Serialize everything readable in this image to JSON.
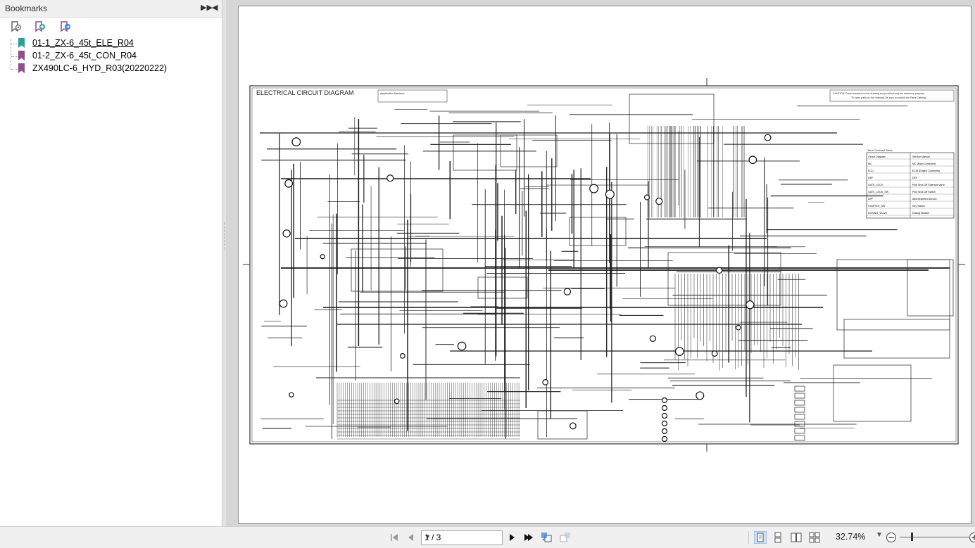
{
  "sidebar": {
    "title": "Bookmarks",
    "bookmarks": [
      {
        "label": "01-1_ZX-6_45t_ELE_R04",
        "color": "#2aa198",
        "selected": true
      },
      {
        "label": "01-2_ZX-6_45t_CON_R04",
        "color": "#8e4f8e",
        "selected": false
      },
      {
        "label": "ZX490LC-6_HYD_R03(20220222)",
        "color": "#8e4f8e",
        "selected": false
      }
    ]
  },
  "document": {
    "heading": "ELECTRICAL CIRCUIT DIAGRAM",
    "applicable_machine": "Applicable Machine",
    "caution": "CAUTION: Parts numbers on the drawing are provided only for reference purpose.",
    "caution2": "To order parts on the drawing, be sure to consult the Parts Catalog.",
    "term_table_title": "Term Contrast Table",
    "term_table_rows": [
      [
        "Circuit Diagram",
        "Service Manual"
      ],
      [
        "MC",
        "MC (Main Controller)"
      ],
      [
        "ECU",
        "ECM (Engine Controller)"
      ],
      [
        "DEF",
        "DEF"
      ],
      [
        "GATE_LOCK",
        "Pilot Shut-Off Solenoid Valve"
      ],
      [
        "GATE_LOCK_SW",
        "Pilot Shut-Off Switch"
      ],
      [
        "DPF",
        "Aftertreatment Device"
      ],
      [
        "STARTER_SW",
        "Key Switch"
      ],
      [
        "DOSING_VALVE",
        "Dosing Module"
      ]
    ]
  },
  "statusbar": {
    "page_indicator": "1 / 3",
    "zoom": "32.74%"
  },
  "icons": {
    "first_page": "first-page-icon",
    "prev_page": "prev-page-icon",
    "next_page": "next-page-icon",
    "last_page": "last-page-icon"
  },
  "colors": {
    "selected_bookmark": "#2aa198",
    "bookmark": "#8e4f8e"
  }
}
